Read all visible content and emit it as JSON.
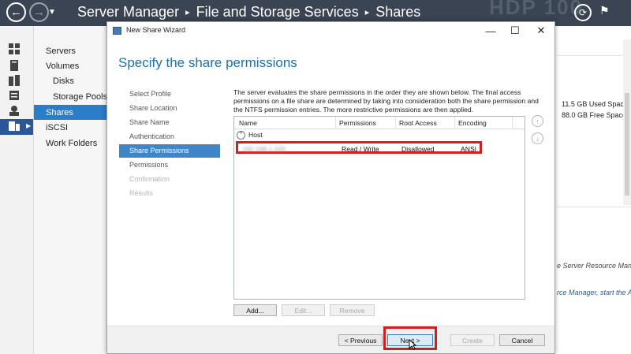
{
  "header": {
    "breadcrumb": [
      "Server Manager",
      "File and Storage Services",
      "Shares"
    ],
    "separator_glyph": "▸",
    "watermark": "HDP 100"
  },
  "left_nav": {
    "items": [
      {
        "label": "Servers"
      },
      {
        "label": "Volumes"
      },
      {
        "label": "Disks"
      },
      {
        "label": "Storage Pools"
      },
      {
        "label": "Shares"
      },
      {
        "label": "iSCSI"
      },
      {
        "label": "Work Folders"
      }
    ],
    "active": "Shares"
  },
  "background_panel": {
    "used_space": "11.5 GB Used Space",
    "free_space": "88.0 GB Free Space",
    "text1": "e Server Resource Manag",
    "text2": "rce Manager, start the A"
  },
  "wizard": {
    "title": "New Share Wizard",
    "heading": "Specify the share permissions",
    "steps": [
      {
        "label": "Select Profile",
        "state": "done"
      },
      {
        "label": "Share Location",
        "state": "done"
      },
      {
        "label": "Share Name",
        "state": "done"
      },
      {
        "label": "Authentication",
        "state": "done"
      },
      {
        "label": "Share Permissions",
        "state": "active"
      },
      {
        "label": "Permissions",
        "state": "pending"
      },
      {
        "label": "Confirmation",
        "state": "disabled"
      },
      {
        "label": "Results",
        "state": "disabled"
      }
    ],
    "description": "The server evaluates the share permissions in the order they are shown below. The final access permissions on a file share are determined by taking into consideration both the share permission and the NTFS permission entries. The more restrictive permissions are then applied.",
    "columns": [
      "Name",
      "Permissions",
      "Root Access",
      "Encoding"
    ],
    "group_label": "Host",
    "rows": [
      {
        "name": "192.168.1.100",
        "permissions": "Read / Write",
        "root_access": "Disallowed",
        "encoding": "ANSI"
      }
    ],
    "list_buttons": {
      "add": "Add...",
      "edit": "Edit...",
      "remove": "Remove"
    },
    "footer_buttons": {
      "previous": "< Previous",
      "next": "Next >",
      "create": "Create",
      "cancel": "Cancel"
    }
  },
  "colors": {
    "header_bg": "#3a4453",
    "accent_blue": "#2b7dc8",
    "heading_blue": "#1f6fa8",
    "highlight_red": "#d01f1f"
  }
}
